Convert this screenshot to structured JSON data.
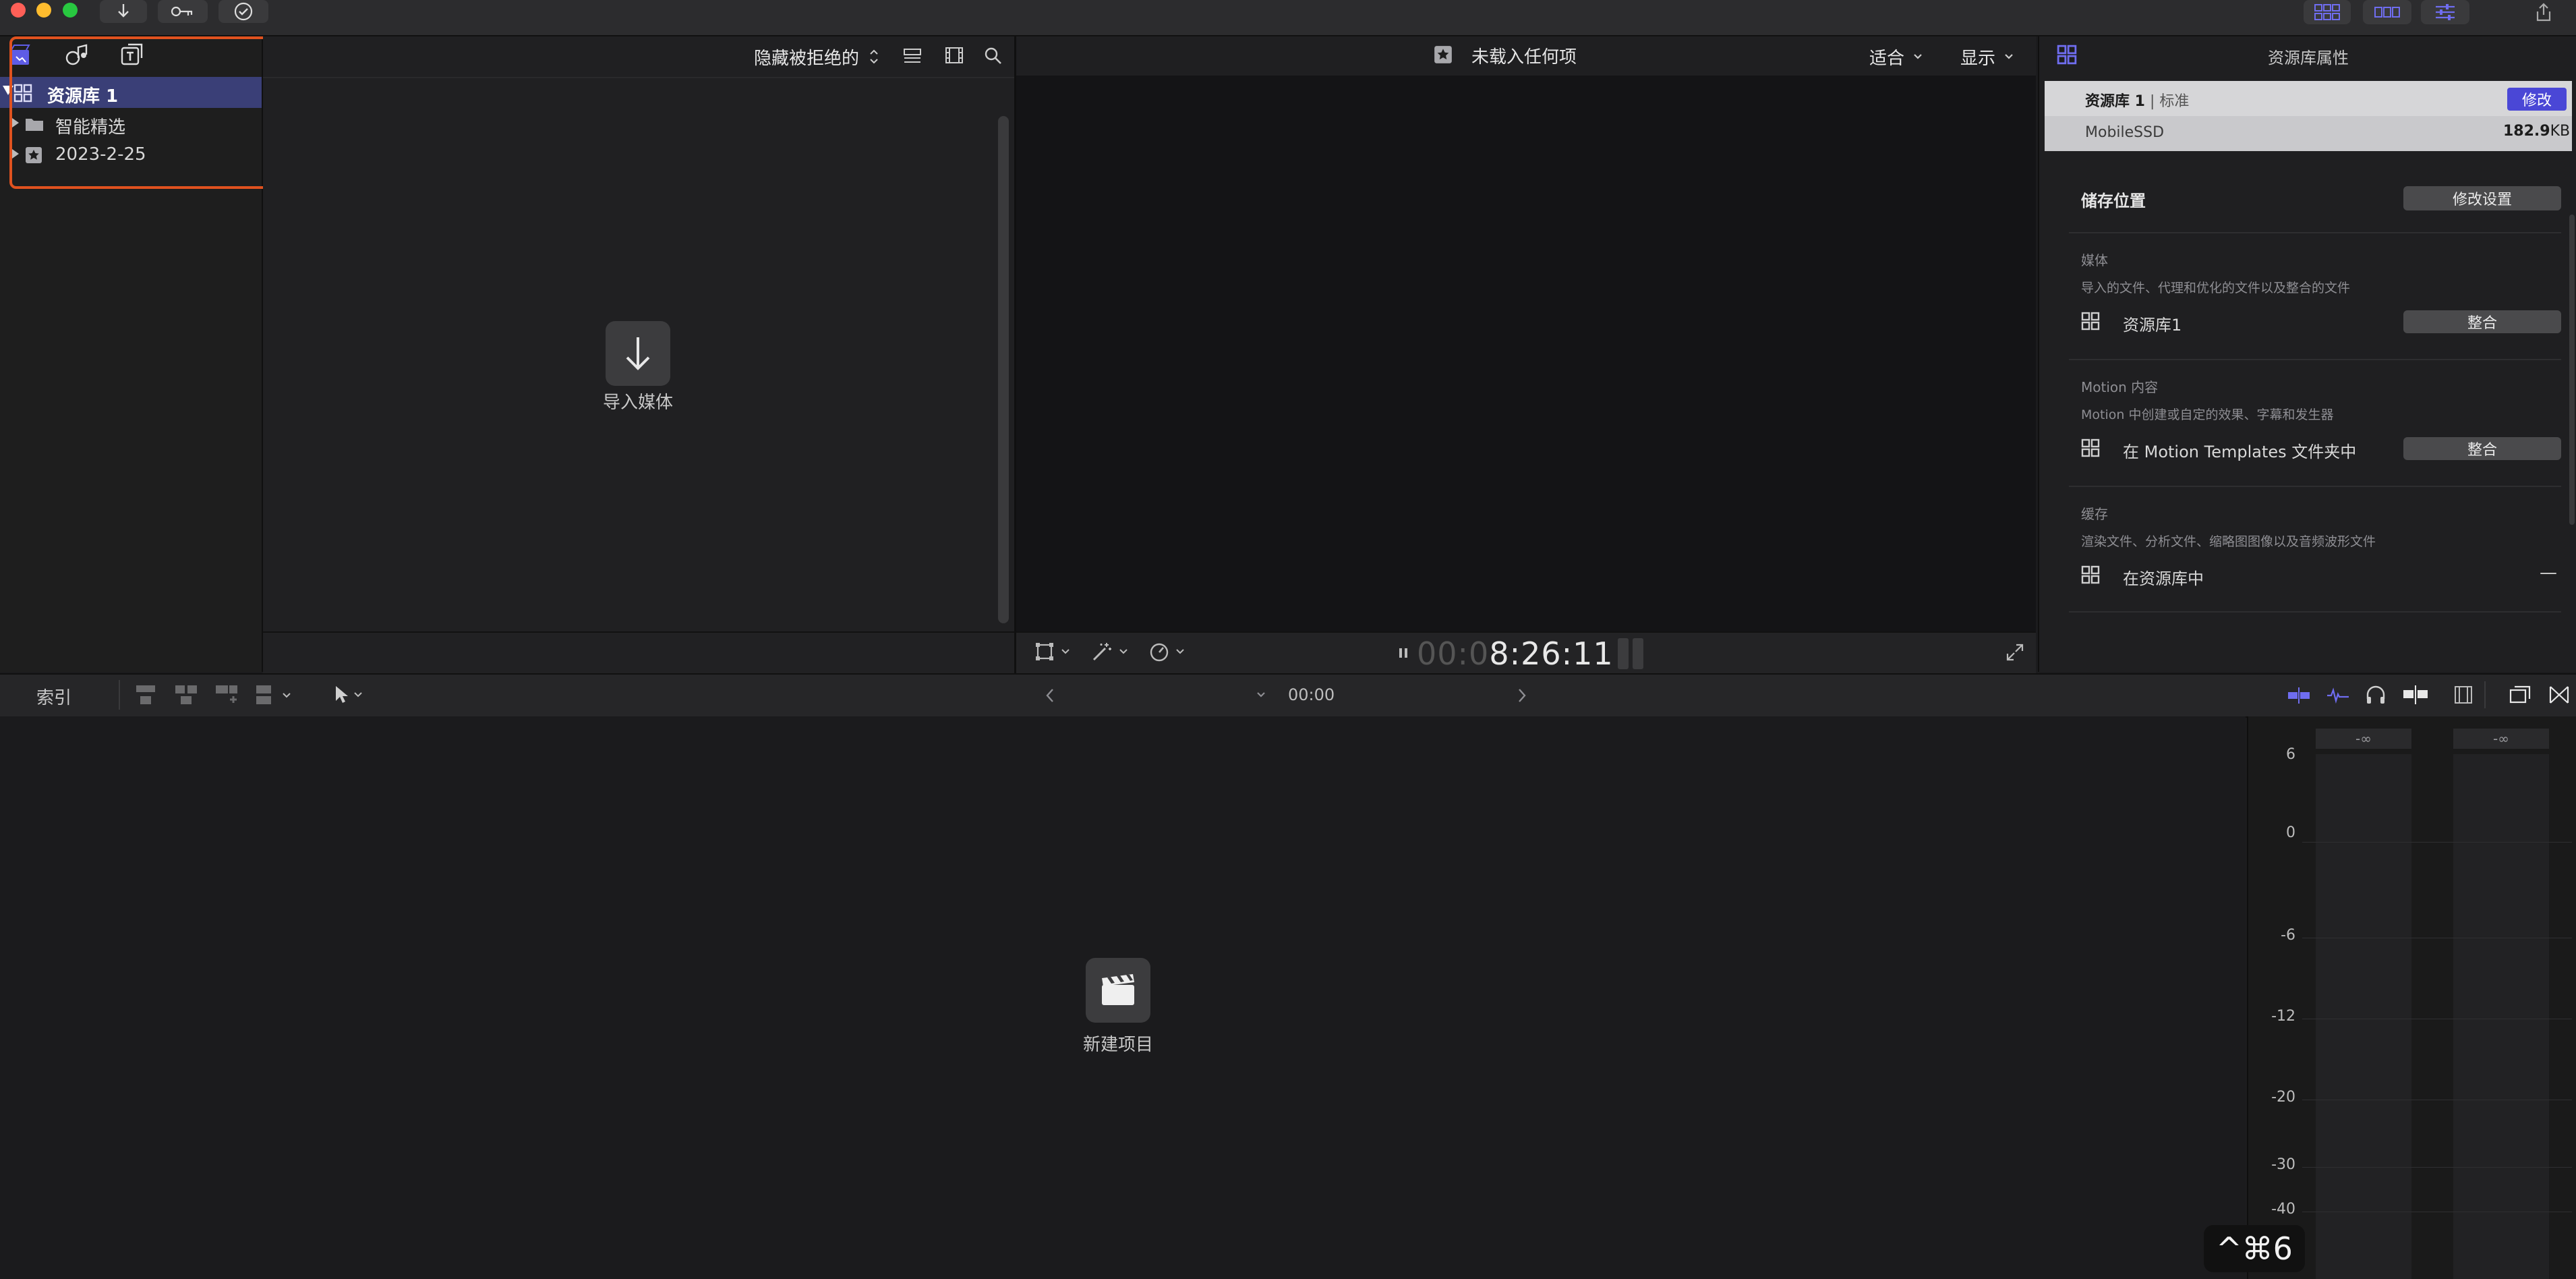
{
  "toolbar": {
    "import_icon": "download-arrow-icon",
    "keyword_icon": "key-icon",
    "check_icon": "checkmark-circle-icon"
  },
  "sidebar": {
    "tab_icons": [
      "libraries-icon",
      "photos-audio-icon",
      "titles-generators-icon"
    ],
    "items": [
      {
        "label": "资源库 1",
        "icon": "library-grid-icon",
        "selected": true
      },
      {
        "label": "智能精选",
        "icon": "folder-icon",
        "selected": false
      },
      {
        "label": "2023-2-25",
        "icon": "event-star-icon",
        "selected": false
      }
    ]
  },
  "browser": {
    "filter_label": "隐藏被拒绝的",
    "import_label": "导入媒体"
  },
  "viewer": {
    "title": "未载入任何项",
    "fit_label": "适合",
    "view_label": "显示",
    "timecode_dim": "00:0",
    "timecode": "8:26:11"
  },
  "inspector": {
    "title": "资源库属性",
    "library_name": "资源库 1",
    "library_type": "标准",
    "modify_label": "修改",
    "storage_device": "MobileSSD",
    "size_value": "182.9",
    "size_unit": "KB",
    "storage_location_label": "储存位置",
    "modify_settings_label": "修改设置",
    "media_heading": "媒体",
    "media_desc": "导入的文件、代理和优化的文件以及整合的文件",
    "media_location": "资源库1",
    "consolidate_label": "整合",
    "motion_heading": "Motion 内容",
    "motion_desc": "Motion 中创建或自定的效果、字幕和发生器",
    "motion_location": "在 Motion Templates 文件夹中",
    "motion_consolidate_label": "整合",
    "cache_heading": "缓存",
    "cache_desc": "渲染文件、分析文件、缩略图图像以及音频波形文件",
    "cache_location": "在资源库中",
    "cache_value": "—"
  },
  "timeline_bar": {
    "index_label": "索引",
    "timecode": "00:00"
  },
  "timeline": {
    "new_project_label": "新建项目"
  },
  "meter": {
    "peak_left": "-∞",
    "peak_right": "-∞",
    "ticks": [
      "6",
      "0",
      "-6",
      "-12",
      "-20",
      "-30",
      "-40"
    ]
  },
  "shortcut": {
    "label": "^⌘6"
  },
  "colors": {
    "accent": "#5e5ce6",
    "selection": "#3a3f77",
    "highlight_box": "#e0521f"
  }
}
